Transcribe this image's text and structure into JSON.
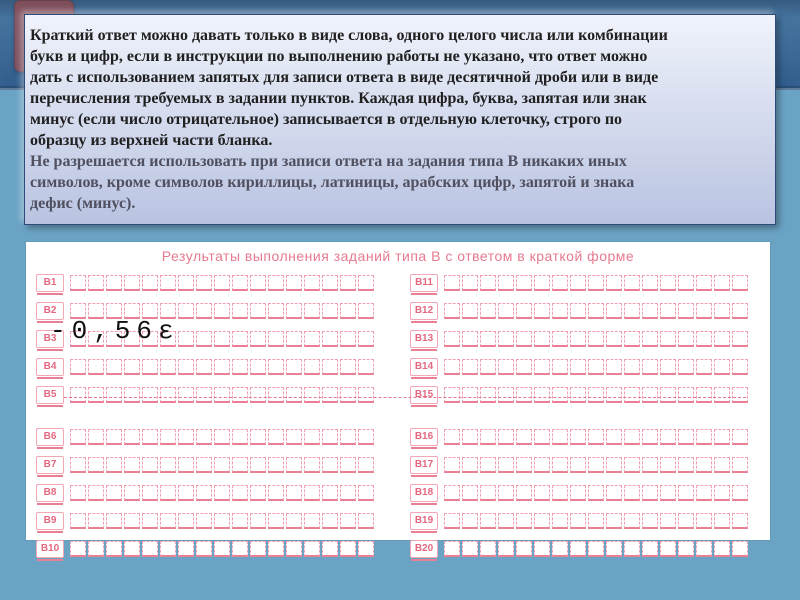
{
  "note": {
    "line1": "Краткий ответ можно давать только в виде слова, одного целого числа или комбинации",
    "line2": " букв и цифр, если в инструкции по выполнению работы не указано, что ответ можно",
    "line3": " дать с использованием запятых для записи ответа в виде десятичной дроби или в виде",
    "line4": " перечисления требуемых в задании пунктов. Каждая цифра, буква, запятая или знак",
    "line5": " минус (если число отрицательное) записывается в отдельную клеточку, строго по",
    "line6": " образцу из верхней части бланка.",
    "line7": "Не разрешается использовать при записи ответа на задания типа В никаких иных",
    "line8": " символов, кроме символов кириллицы, латиницы, арабских цифр, запятой и знака",
    "line9": "дефис (минус)."
  },
  "form": {
    "title": "Результаты выполнения заданий типа В с ответом в краткой форме",
    "left_labels": [
      "В1",
      "В2",
      "В3",
      "В4",
      "В5",
      "В6",
      "В7",
      "В8",
      "В9",
      "В10"
    ],
    "right_labels": [
      "В11",
      "В12",
      "В13",
      "В14",
      "В15",
      "В16",
      "В17",
      "В18",
      "В19",
      "В20"
    ],
    "cells_per_row": 17,
    "break_after_index": 4
  },
  "sample_answer": "-0,56ε"
}
